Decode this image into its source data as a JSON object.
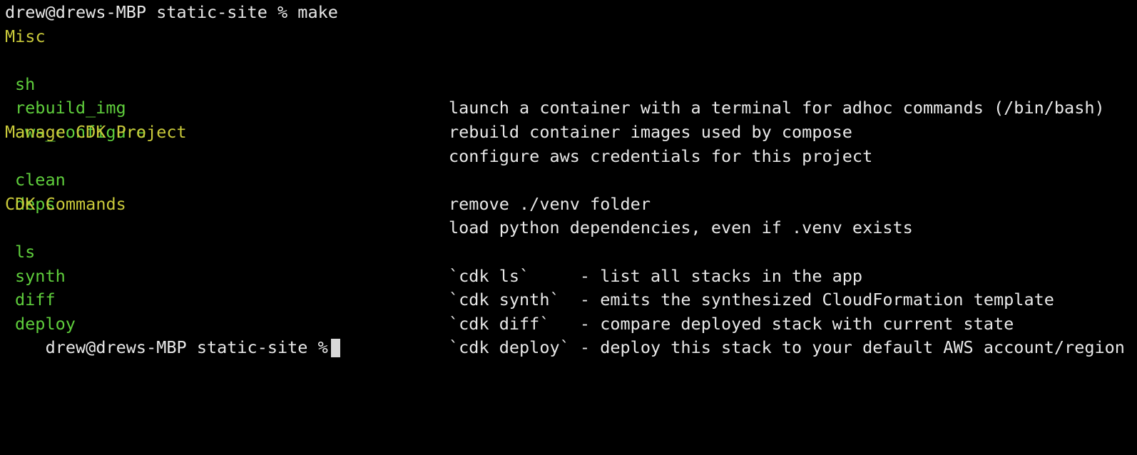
{
  "terminal": {
    "prompt_line": "drew@drews-MBP static-site % make",
    "last_prompt": "drew@drews-MBP static-site %",
    "sections": [
      {
        "title": "Misc",
        "targets": [
          {
            "name": "sh",
            "desc": "launch a container with a terminal for adhoc commands (/bin/bash)"
          },
          {
            "name": "rebuild_img",
            "desc": "rebuild container images used by compose"
          },
          {
            "name": "aws_configure",
            "desc": "configure aws credentials for this project"
          }
        ]
      },
      {
        "title": "Manage CDK Project",
        "targets": [
          {
            "name": "clean",
            "desc": "remove ./venv folder"
          },
          {
            "name": "deps",
            "desc": "load python dependencies, even if .venv exists"
          }
        ]
      },
      {
        "title": "CDK Commands",
        "targets": [
          {
            "name": "ls",
            "desc": "`cdk ls`     - list all stacks in the app"
          },
          {
            "name": "synth",
            "desc": "`cdk synth`  - emits the synthesized CloudFormation template"
          },
          {
            "name": "diff",
            "desc": "`cdk diff`   - compare deployed stack with current state"
          },
          {
            "name": "deploy",
            "desc": "`cdk deploy` - deploy this stack to your default AWS account/region"
          }
        ]
      }
    ],
    "colors": {
      "background": "#000000",
      "foreground": "#e8e8e8",
      "section": "#c9c93a",
      "target": "#5fce3c"
    }
  }
}
